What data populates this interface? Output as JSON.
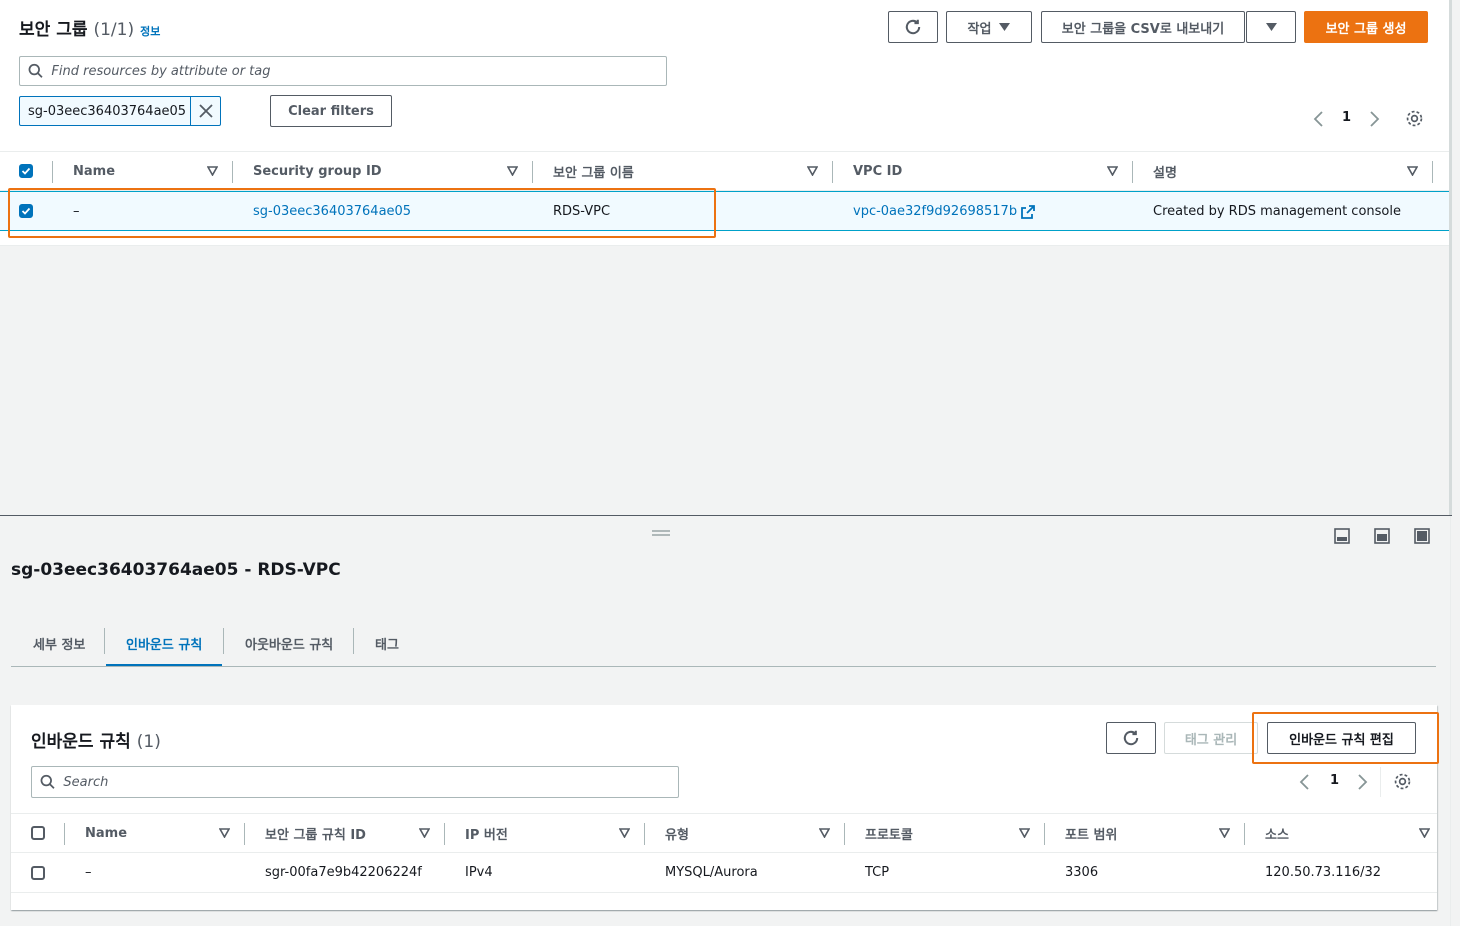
{
  "security_groups": {
    "title": "보안 그룹",
    "count": "(1/1)",
    "info": "정보",
    "refresh_icon": "refresh-icon",
    "actions_label": "작업",
    "export_label": "보안 그룹을 CSV로 내보내기",
    "create_label": "보안 그룹 생성",
    "search_placeholder": "Find resources by attribute or tag",
    "filter_token": "sg-03eec36403764ae05",
    "clear_filters": "Clear filters",
    "page": "1",
    "columns": [
      "Name",
      "Security group ID",
      "보안 그룹 이름",
      "VPC ID",
      "설명"
    ],
    "rows": [
      {
        "name": "–",
        "sg_id": "sg-03eec36403764ae05",
        "sg_name": "RDS-VPC",
        "vpc_id": "vpc-0ae32f9d92698517b",
        "description": "Created by RDS management console"
      }
    ]
  },
  "detail": {
    "title": "sg-03eec36403764ae05 - RDS-VPC",
    "tabs": [
      "세부 정보",
      "인바운드 규칙",
      "아웃바운드 규칙",
      "태그"
    ],
    "active_tab": "인바운드 규칙"
  },
  "inbound": {
    "title": "인바운드 규칙",
    "count": "(1)",
    "manage_tags": "태그 관리",
    "edit_label": "인바운드 규칙 편집",
    "search_placeholder": "Search",
    "page": "1",
    "columns": [
      "Name",
      "보안 그룹 규칙 ID",
      "IP 버전",
      "유형",
      "프로토콜",
      "포트 범위",
      "소스"
    ],
    "rows": [
      {
        "name": "–",
        "rule_id": "sgr-00fa7e9b42206224f",
        "ip_version": "IPv4",
        "type": "MYSQL/Aurora",
        "protocol": "TCP",
        "port_range": "3306",
        "source": "120.50.73.116/32"
      }
    ]
  },
  "colors": {
    "accent": "#0073bb",
    "primary_button": "#ec7211",
    "highlight": "#ec7211"
  }
}
